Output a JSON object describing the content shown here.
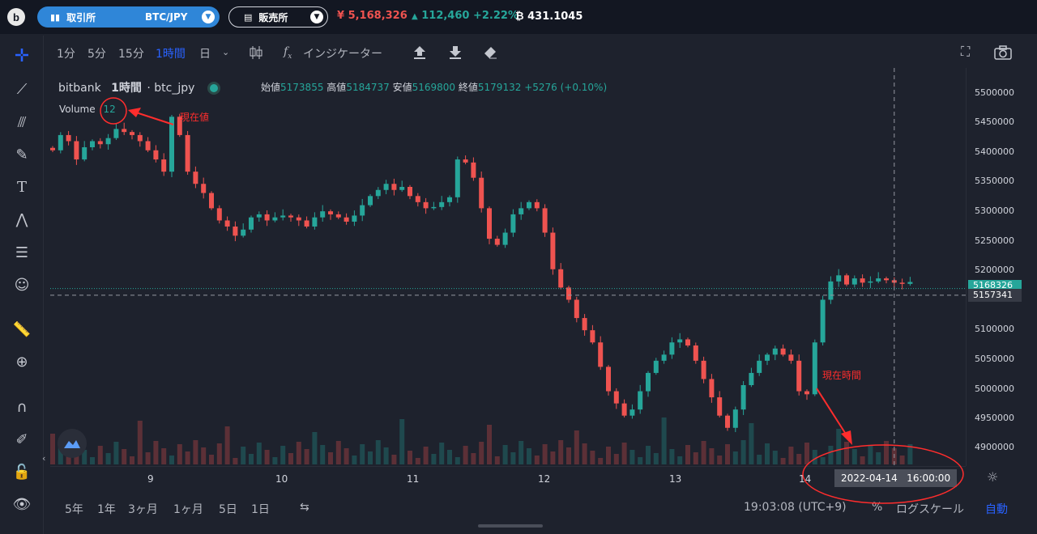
{
  "topbar": {
    "exchange_label": "取引所",
    "pair": "BTC/JPY",
    "hanbaisho_label": "販売所",
    "last_price": "¥ 5,168,326",
    "change": "112,460 +2.22%",
    "btc_balance": "431.1045"
  },
  "timeframes": [
    "1分",
    "5分",
    "15分",
    "1時間",
    "日"
  ],
  "active_timeframe": "1時間",
  "indicator_label": "インジケーター",
  "legend": {
    "source": "bitbank",
    "interval": "1時間",
    "symbol": "btc_jpy",
    "open_label": "始値",
    "open": "5173855",
    "high_label": "高値",
    "high": "5184737",
    "low_label": "安値",
    "low": "5169800",
    "close_label": "終値",
    "close": "5179132",
    "change": "+5276 (+0.10%)",
    "volume_label": "Volume",
    "volume_value": "12"
  },
  "y_axis": {
    "ticks": [
      "5500000",
      "5450000",
      "5400000",
      "5350000",
      "5300000",
      "5250000",
      "5200000",
      "5150000",
      "5100000",
      "5050000",
      "5000000",
      "4950000",
      "4900000"
    ],
    "current_label": "5168326",
    "cursor_label": "5157341"
  },
  "x_axis": {
    "ticks": [
      "9",
      "10",
      "11",
      "12",
      "13",
      "14"
    ],
    "cursor_time": "2022-04-14   16:00:00"
  },
  "bottom": {
    "ranges": [
      "5年",
      "1年",
      "3ヶ月",
      "1ヶ月",
      "5日",
      "1日"
    ],
    "clock": "19:03:08 (UTC+9)",
    "percent": "%",
    "log_scale": "ログスケール",
    "auto": "自動"
  },
  "annotations": {
    "current_value": "現在値",
    "current_time": "現在時間"
  },
  "colors": {
    "up": "#26a69a",
    "down": "#ef5350",
    "accent": "#2962ff",
    "annot": "#ff2d2d"
  },
  "chart_data": {
    "type": "candlestick",
    "ylim": [
      4880000,
      5530000
    ],
    "candles_close": [
      5395000,
      5420000,
      5410000,
      5380000,
      5400000,
      5410000,
      5405000,
      5415000,
      5430000,
      5425000,
      5420000,
      5410000,
      5395000,
      5380000,
      5360000,
      5450000,
      5420000,
      5360000,
      5340000,
      5325000,
      5300000,
      5280000,
      5270000,
      5255000,
      5265000,
      5285000,
      5290000,
      5280000,
      5285000,
      5288000,
      5285000,
      5280000,
      5270000,
      5285000,
      5295000,
      5290000,
      5285000,
      5278000,
      5288000,
      5305000,
      5320000,
      5330000,
      5340000,
      5330000,
      5335000,
      5320000,
      5310000,
      5300000,
      5302000,
      5310000,
      5318000,
      5380000,
      5375000,
      5350000,
      5300000,
      5250000,
      5240000,
      5260000,
      5290000,
      5300000,
      5310000,
      5300000,
      5260000,
      5200000,
      5170000,
      5150000,
      5120000,
      5100000,
      5080000,
      5040000,
      5000000,
      4980000,
      4960000,
      4970000,
      5000000,
      5030000,
      5050000,
      5060000,
      5080000,
      5085000,
      5075000,
      5050000,
      5020000,
      4990000,
      4960000,
      4940000,
      4970000,
      5010000,
      5030000,
      5050000,
      5060000,
      5070000,
      5060000,
      5050000,
      5000000,
      4995000,
      5080000,
      5150000,
      5180000,
      5190000,
      5175000,
      5185000,
      5178000,
      5180000,
      5185000,
      5182000,
      5178000,
      5176000,
      5179132
    ]
  }
}
